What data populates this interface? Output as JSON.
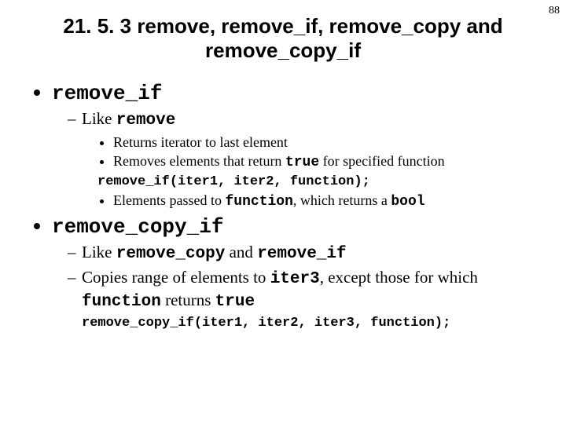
{
  "pageNumber": "88",
  "title": "21. 5. 3 remove, remove_if, remove_copy and remove_copy_if",
  "b1": {
    "head": "remove_if",
    "sub1_a": "Like ",
    "sub1_b": "remove",
    "pt1": "Returns iterator to last element",
    "pt2_a": "Removes elements that return ",
    "pt2_b": "true",
    "pt2_c": " for specified function",
    "code": "remove_if(iter1, iter2, function);",
    "pt3_a": "Elements passed to ",
    "pt3_b": "function",
    "pt3_c": ", which returns a ",
    "pt3_d": "bool"
  },
  "b2": {
    "head": "remove_copy_if",
    "sub1_a": "Like ",
    "sub1_b": "remove_copy",
    "sub1_c": " and ",
    "sub1_d": "remove_if",
    "sub2_a": "Copies range of elements to ",
    "sub2_b": "iter3",
    "sub2_c": ", except those for which ",
    "sub2_d": "function",
    "sub2_e": " returns ",
    "sub2_f": "true",
    "code": "remove_copy_if(iter1, iter2, iter3, function);"
  }
}
